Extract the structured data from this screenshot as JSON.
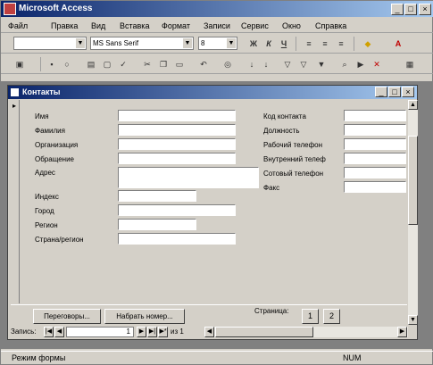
{
  "app": {
    "title": "Microsoft Access"
  },
  "window_buttons": {
    "minimize": "_",
    "restore": "□",
    "close": "×"
  },
  "menu": [
    "Файл",
    "Правка",
    "Вид",
    "Вставка",
    "Формат",
    "Записи",
    "Сервис",
    "Окно",
    "Справка"
  ],
  "format_toolbar": {
    "object_combo": "",
    "font": "MS Sans Serif",
    "size": "8",
    "bold": "Ж",
    "italic": "К",
    "underline": "Ч",
    "font_color_glyph": "A"
  },
  "form": {
    "title": "Контакты",
    "left_labels": [
      "Имя",
      "Фамилия",
      "Организация",
      "Обращение",
      "Адрес",
      "Индекс",
      "Город",
      "Регион",
      "Страна/регион"
    ],
    "right_labels": [
      "Код контакта",
      "Должность",
      "Рабочий телефон",
      "Внутренний телеф",
      "Сотовый телефон",
      "Факс"
    ],
    "buttons": {
      "calls": "Переговоры...",
      "dial": "Набрать номер..."
    },
    "page_label": "Страница:",
    "page_buttons": [
      "1",
      "2"
    ]
  },
  "navigation": {
    "label": "Запись:",
    "current": "1",
    "of_label": "из 1"
  },
  "status": {
    "mode": "Режим формы",
    "num": "NUM"
  }
}
